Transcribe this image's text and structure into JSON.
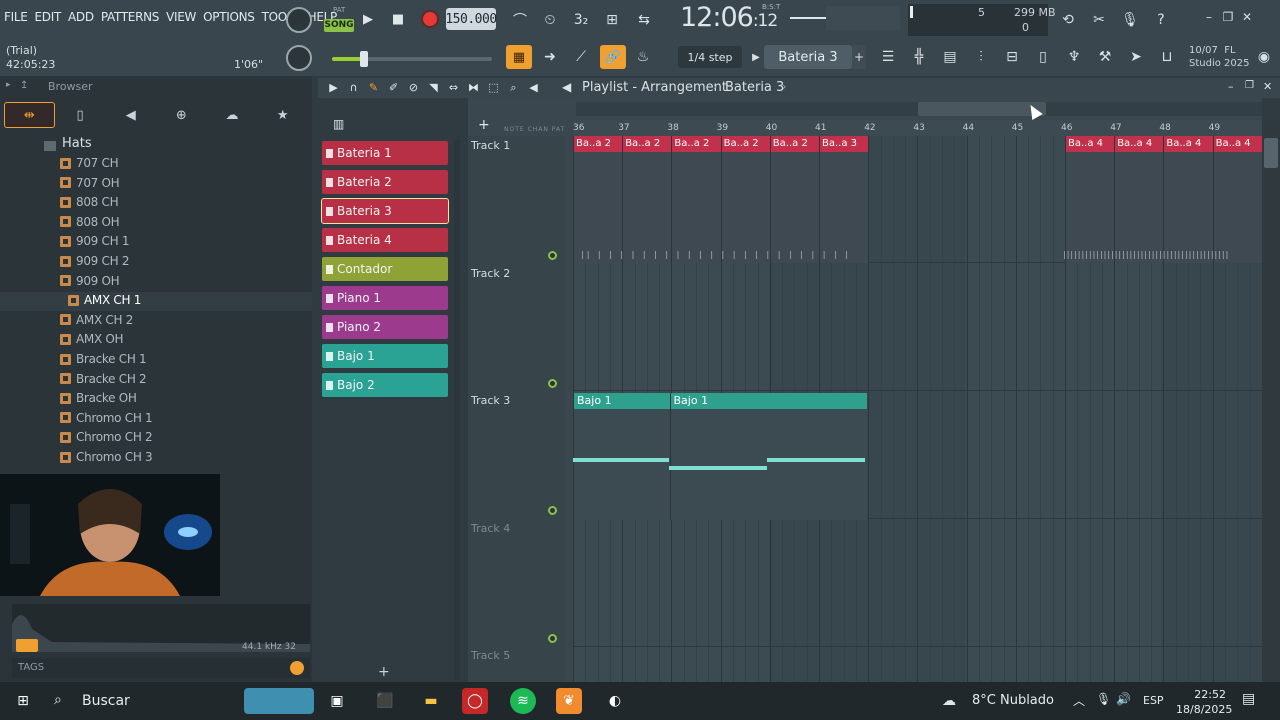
{
  "menu": [
    "FILE",
    "EDIT",
    "ADD",
    "PATTERNS",
    "VIEW",
    "OPTIONS",
    "TOOLS",
    "HELP"
  ],
  "transport": {
    "pat_label": "PAT",
    "song_label": "SONG",
    "tempo": "150.000",
    "time_main": "12:06",
    "time_sub": "12",
    "bst_label": "B:S:T",
    "cpu_value": "5",
    "memory": "299 MB",
    "polyphony": "0"
  },
  "hint": {
    "title": "(Trial)",
    "time": "42:05:23",
    "length": "1'06\""
  },
  "toolbar2": {
    "step": "1/4 step",
    "pattern": "Bateria 3",
    "add": "+",
    "version_date": "10/07",
    "version_fl": "FL",
    "version_name": "Studio 2025"
  },
  "browser": {
    "title": "Browser",
    "folder": "Hats",
    "items": [
      "707 CH",
      "707 OH",
      "808 CH",
      "808 OH",
      "909 CH 1",
      "909 CH 2",
      "909 OH",
      "AMX CH 1",
      "AMX CH 2",
      "AMX OH",
      "Bracke CH 1",
      "Bracke CH 2",
      "Bracke OH",
      "Chromo CH 1",
      "Chromo CH 2",
      "Chromo CH 3"
    ],
    "selected_index": 7,
    "sample_rate": "44.1 kHz 32",
    "tags_label": "TAGS"
  },
  "playlist": {
    "title": "Playlist - Arrangement",
    "current_pattern": "Bateria 3",
    "add": "+",
    "patterns": [
      {
        "name": "Bateria 1",
        "color": "#b83045"
      },
      {
        "name": "Bateria 2",
        "color": "#b83045"
      },
      {
        "name": "Bateria 3",
        "color": "#b83045"
      },
      {
        "name": "Bateria 4",
        "color": "#b83045"
      },
      {
        "name": "Contador",
        "color": "#8fa236"
      },
      {
        "name": "Piano 1",
        "color": "#9c3a8e"
      },
      {
        "name": "Piano 2",
        "color": "#9c3a8e"
      },
      {
        "name": "Bajo 1",
        "color": "#2aa294"
      },
      {
        "name": "Bajo 2",
        "color": "#2aa294"
      }
    ],
    "tracks": [
      "Track 1",
      "Track 2",
      "Track 3",
      "Track 4",
      "Track 5"
    ],
    "ruler": [
      "36",
      "37",
      "38",
      "39",
      "40",
      "41",
      "42",
      "43",
      "44",
      "45",
      "46",
      "47",
      "48",
      "49"
    ],
    "clips_track1": [
      "Ba..a 2",
      "Ba..a 2",
      "Ba..a 2",
      "Ba..a 2",
      "Ba..a 2",
      "Ba..a 3",
      "Ba..a 4",
      "Ba..a 4",
      "Ba..a 4",
      "Ba..a 4"
    ],
    "clips_track3": [
      "Bajo 1",
      "Bajo 1"
    ]
  },
  "taskbar": {
    "search": "Buscar",
    "weather": "8°C  Nublado",
    "lang": "ESP",
    "time": "22:52",
    "date": "18/8/2025"
  },
  "icons": {
    "record": "record-icon",
    "play": "play-icon",
    "stop": "stop-icon"
  }
}
